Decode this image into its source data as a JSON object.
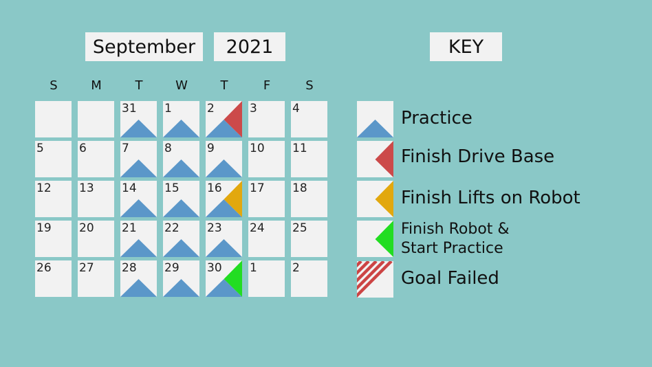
{
  "header": {
    "month": "September",
    "year": "2021",
    "key_title": "KEY"
  },
  "weekdays": [
    "S",
    "M",
    "T",
    "W",
    "T",
    "F",
    "S"
  ],
  "weeks": [
    [
      {
        "day": ""
      },
      {
        "day": ""
      },
      {
        "day": "31",
        "marks": [
          "practice"
        ]
      },
      {
        "day": "1",
        "marks": [
          "practice"
        ]
      },
      {
        "day": "2",
        "marks": [
          "practice",
          "drive"
        ]
      },
      {
        "day": "3"
      },
      {
        "day": "4"
      }
    ],
    [
      {
        "day": "5"
      },
      {
        "day": "6"
      },
      {
        "day": "7",
        "marks": [
          "practice"
        ]
      },
      {
        "day": "8",
        "marks": [
          "practice"
        ]
      },
      {
        "day": "9",
        "marks": [
          "practice"
        ]
      },
      {
        "day": "10"
      },
      {
        "day": "11"
      }
    ],
    [
      {
        "day": "12"
      },
      {
        "day": "13"
      },
      {
        "day": "14",
        "marks": [
          "practice"
        ]
      },
      {
        "day": "15",
        "marks": [
          "practice"
        ]
      },
      {
        "day": "16",
        "marks": [
          "practice",
          "lifts"
        ]
      },
      {
        "day": "17"
      },
      {
        "day": "18"
      }
    ],
    [
      {
        "day": "19"
      },
      {
        "day": "20"
      },
      {
        "day": "21",
        "marks": [
          "practice"
        ]
      },
      {
        "day": "22",
        "marks": [
          "practice"
        ]
      },
      {
        "day": "23",
        "marks": [
          "practice"
        ]
      },
      {
        "day": "24"
      },
      {
        "day": "25"
      }
    ],
    [
      {
        "day": "26"
      },
      {
        "day": "27"
      },
      {
        "day": "28",
        "marks": [
          "practice"
        ]
      },
      {
        "day": "29",
        "marks": [
          "practice"
        ]
      },
      {
        "day": "30",
        "marks": [
          "practice",
          "robot"
        ]
      },
      {
        "day": "1"
      },
      {
        "day": "2"
      }
    ]
  ],
  "key": [
    {
      "id": "practice",
      "label": "Practice"
    },
    {
      "id": "drive",
      "label": "Finish Drive Base"
    },
    {
      "id": "lifts",
      "label": "Finish Lifts on Robot"
    },
    {
      "id": "robot",
      "label_line1": "Finish Robot &",
      "label_line2": "Start Practice"
    },
    {
      "id": "failed",
      "label": "Goal Failed"
    }
  ],
  "colors": {
    "practice": "#5b97c9",
    "drive": "#cc4a4a",
    "lifts": "#e2a80e",
    "robot": "#22dd22",
    "failed": "#cc4444"
  }
}
